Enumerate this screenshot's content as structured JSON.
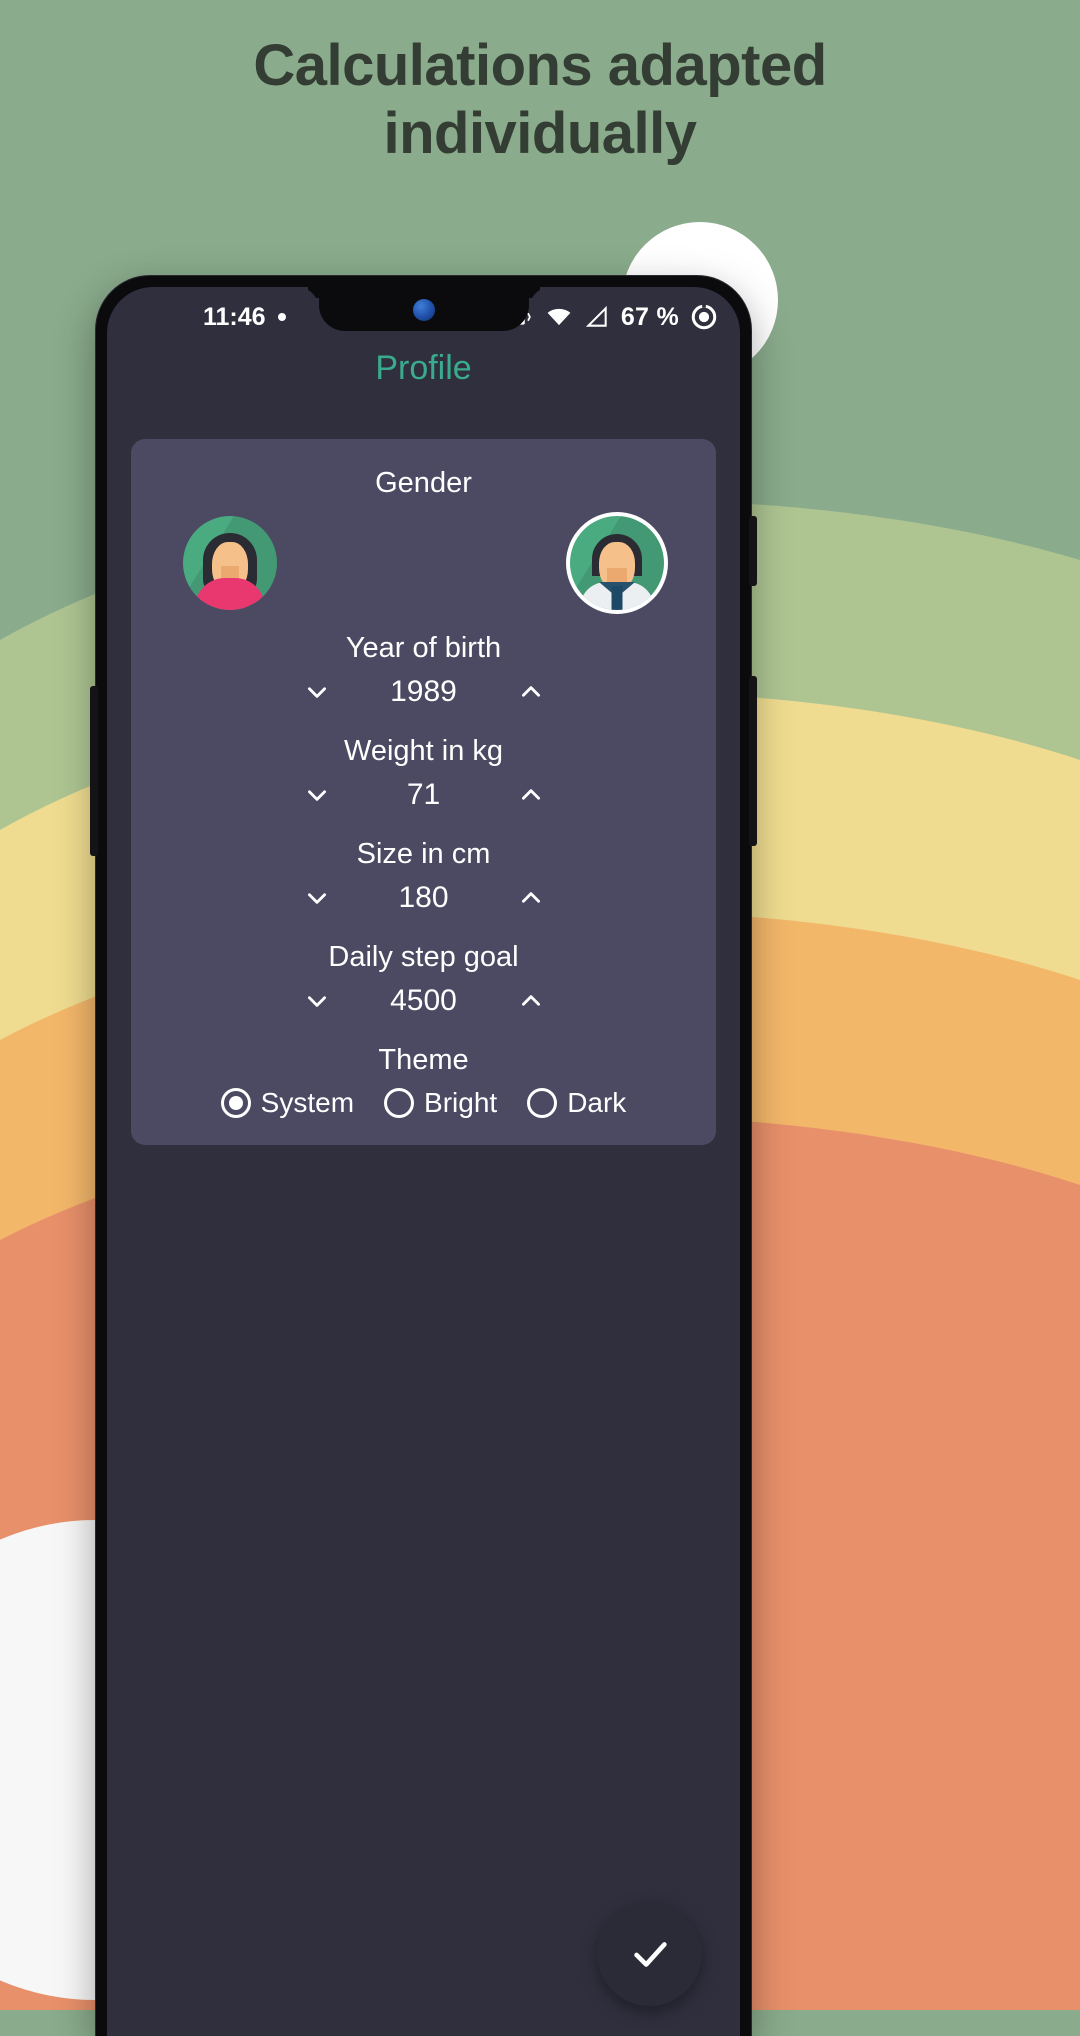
{
  "promo": {
    "headline_line1": "Calculations adapted",
    "headline_line2": "individually",
    "text_color": "#333d33",
    "background_bands": [
      "#8aab8c",
      "#aec592",
      "#efdc90",
      "#f3b76a",
      "#e8906a",
      "#f7f7f7"
    ]
  },
  "status_bar": {
    "time": "11:46",
    "notification_dot": "•",
    "icons": [
      "alarm-icon",
      "vpn-key-icon",
      "bluetooth-icon",
      "vibrate-icon",
      "wifi-icon",
      "cell-signal-icon"
    ],
    "battery_percent": "67 %",
    "battery_icon": "battery-circle-icon"
  },
  "appbar": {
    "title": "Profile",
    "accent_color": "#3aab8c"
  },
  "profile": {
    "gender": {
      "label": "Gender",
      "options": [
        {
          "id": "female",
          "name": "female-avatar",
          "selected": false
        },
        {
          "id": "male",
          "name": "male-avatar",
          "selected": true
        }
      ]
    },
    "fields": [
      {
        "id": "year_of_birth",
        "label": "Year of birth",
        "value": "1989"
      },
      {
        "id": "weight_kg",
        "label": "Weight in kg",
        "value": "71"
      },
      {
        "id": "size_cm",
        "label": "Size in cm",
        "value": "180"
      },
      {
        "id": "daily_step_goal",
        "label": "Daily step goal",
        "value": "4500"
      }
    ],
    "theme": {
      "label": "Theme",
      "options": [
        {
          "id": "system",
          "label": "System",
          "selected": true
        },
        {
          "id": "bright",
          "label": "Bright",
          "selected": false
        },
        {
          "id": "dark",
          "label": "Dark",
          "selected": false
        }
      ]
    },
    "card_color": "#4b4a62",
    "screen_color": "#2f2f3e"
  },
  "fab": {
    "icon": "check-icon",
    "color": "#2b2b38"
  }
}
